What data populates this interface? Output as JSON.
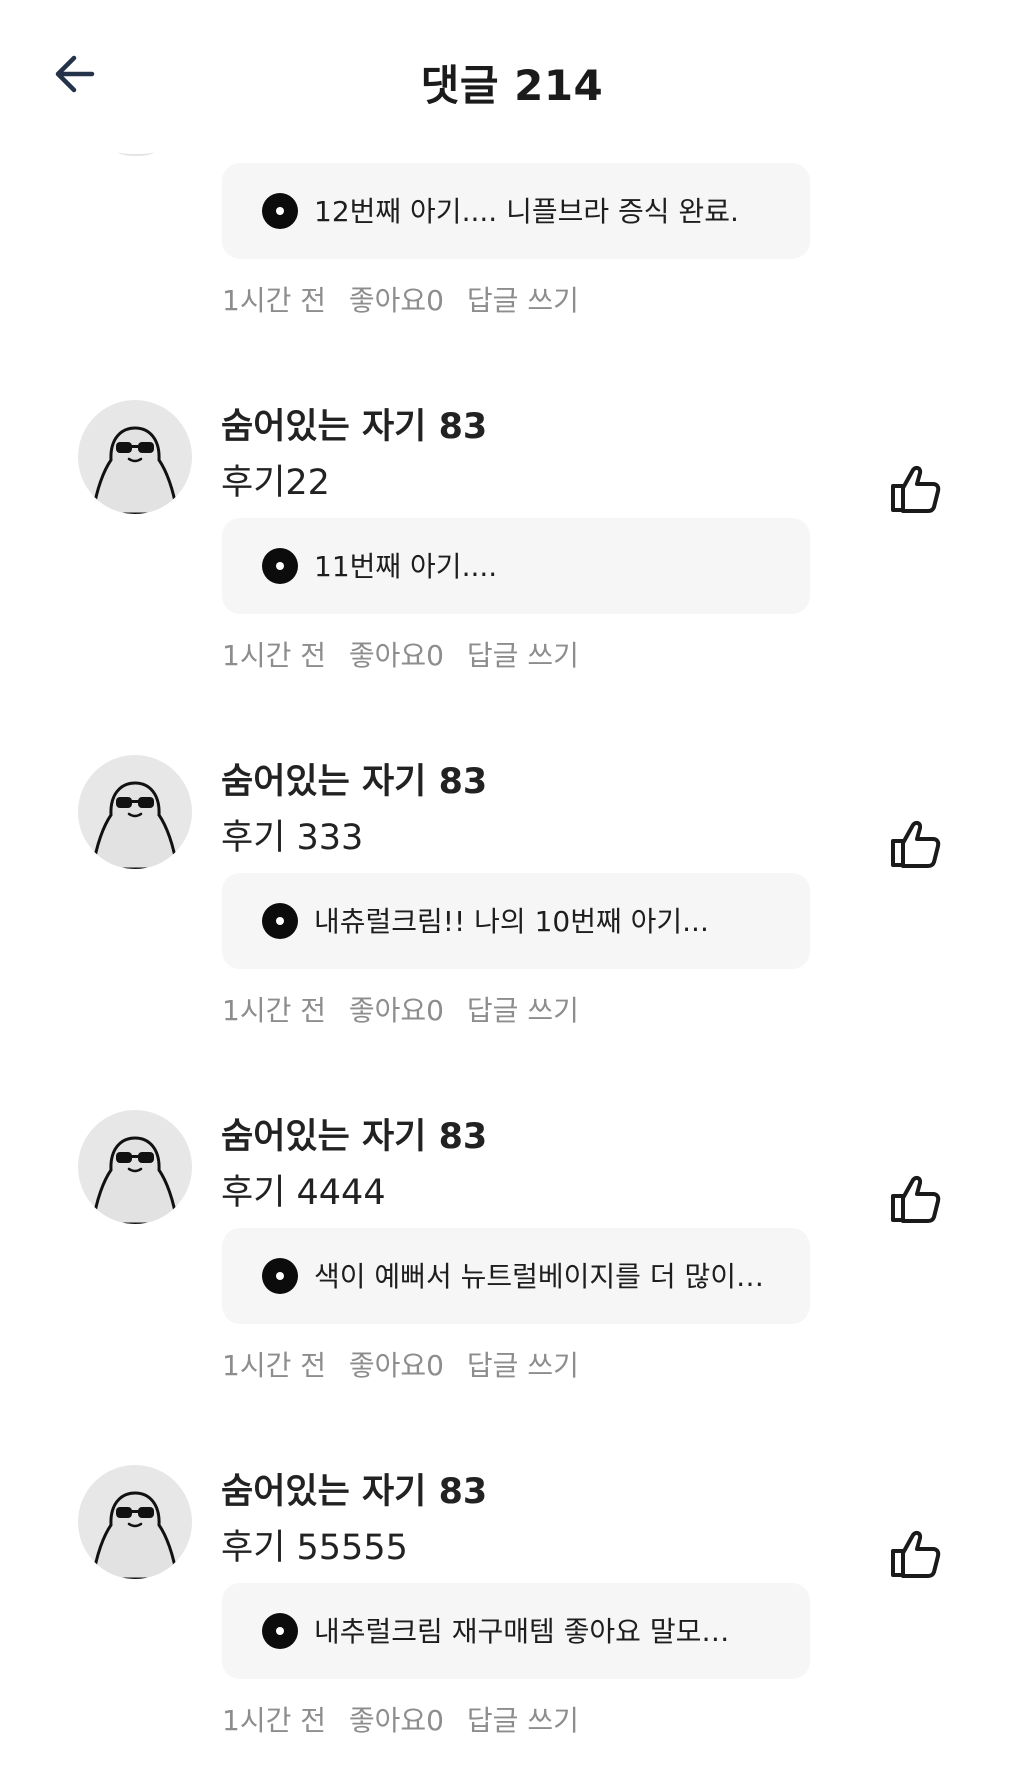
{
  "header": {
    "title": "댓글 214"
  },
  "first_comment": {
    "product": "12번째 아기.... 니플브라 증식 완료.",
    "time": "1시간 전",
    "likes": "좋아요0",
    "reply": "답글 쓰기"
  },
  "comments": [
    {
      "author": "숨어있는 자기 83",
      "text": "후기22",
      "product": "11번째 아기....",
      "time": "1시간 전",
      "likes": "좋아요0",
      "reply": "답글 쓰기"
    },
    {
      "author": "숨어있는 자기 83",
      "text": "후기 333",
      "product": "내츄럴크림!! 나의 10번째 아기...",
      "time": "1시간 전",
      "likes": "좋아요0",
      "reply": "답글 쓰기"
    },
    {
      "author": "숨어있는 자기 83",
      "text": "후기 4444",
      "product": "색이 예뻐서 뉴트럴베이지를 더 많이…",
      "time": "1시간 전",
      "likes": "좋아요0",
      "reply": "답글 쓰기"
    },
    {
      "author": "숨어있는 자기 83",
      "text": "후기 55555",
      "product": "내추럴크림   재구매템 좋아요 말모…",
      "time": "1시간 전",
      "likes": "좋아요0",
      "reply": "답글 쓰기"
    }
  ],
  "icons": {
    "back": "arrow-left-icon",
    "like": "thumbs-up-icon",
    "product": "record-dot-icon",
    "avatar": "sunglasses-ghost-avatar"
  },
  "colors": {
    "card_bg": "#f6f6f6",
    "meta_text": "#8d8d8d",
    "primary_text": "#1b1b1b"
  }
}
